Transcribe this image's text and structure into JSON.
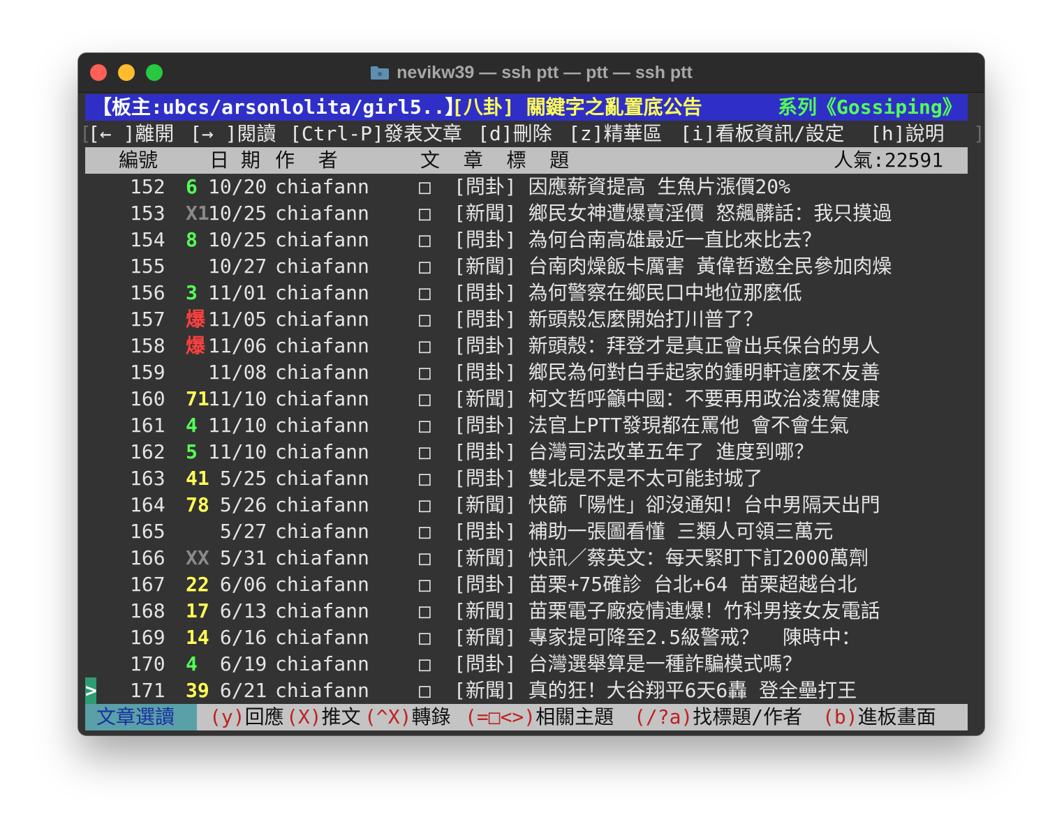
{
  "window": {
    "title": "nevikw39 — ssh ptt — ptt — ssh ptt",
    "icons": [
      "folder-icon"
    ]
  },
  "header": {
    "moderators": "【板主:ubcs/arsonlolita/girl5..】",
    "board_title": "[八卦] 關鍵字之亂置底公告",
    "series": "系列《Gossiping》"
  },
  "menu": {
    "left_edge": "[",
    "right_edge": "]",
    "items": [
      "[← ]離開",
      "[→ ]閱讀",
      "[Ctrl-P]發表文章",
      "[d]刪除",
      "[z]精華區",
      "[i]看板資訊/設定",
      "[h]說明"
    ]
  },
  "columns": {
    "number": "編號",
    "date": "日 期",
    "author": "作  者",
    "title": "文  章  標  題",
    "popularity": "人氣:22591"
  },
  "cursor": ">",
  "colors": {
    "rec_green": "#55ff55",
    "rec_yellow": "#ffff55",
    "rec_red": "#ff4040",
    "rec_gray": "#8a8a8a"
  },
  "articles": [
    {
      "num": "152",
      "rec": "6",
      "rec_color": "green",
      "date": "10/20",
      "author": "chiafann",
      "mark": "□",
      "title": "[問卦] 因應薪資提高 生魚片漲價20%"
    },
    {
      "num": "153",
      "rec": "X1",
      "rec_color": "gray",
      "date": "10/25",
      "author": "chiafann",
      "mark": "□",
      "title": "[新聞] 鄉民女神遭爆賣淫價 怒飆髒話：我只摸過"
    },
    {
      "num": "154",
      "rec": "8",
      "rec_color": "green",
      "date": "10/25",
      "author": "chiafann",
      "mark": "□",
      "title": "[問卦] 為何台南高雄最近一直比來比去？"
    },
    {
      "num": "155",
      "rec": "",
      "rec_color": "none",
      "date": "10/27",
      "author": "chiafann",
      "mark": "□",
      "title": "[新聞] 台南肉燥飯卡厲害 黃偉哲邀全民參加肉燥"
    },
    {
      "num": "156",
      "rec": "3",
      "rec_color": "green",
      "date": "11/01",
      "author": "chiafann",
      "mark": "□",
      "title": "[問卦] 為何警察在鄉民口中地位那麼低"
    },
    {
      "num": "157",
      "rec": "爆",
      "rec_color": "red",
      "date": "11/05",
      "author": "chiafann",
      "mark": "□",
      "title": "[問卦] 新頭殼怎麼開始打川普了？"
    },
    {
      "num": "158",
      "rec": "爆",
      "rec_color": "red",
      "date": "11/06",
      "author": "chiafann",
      "mark": "□",
      "title": "[問卦] 新頭殼：拜登才是真正會出兵保台的男人"
    },
    {
      "num": "159",
      "rec": "",
      "rec_color": "none",
      "date": "11/08",
      "author": "chiafann",
      "mark": "□",
      "title": "[問卦] 鄉民為何對白手起家的鍾明軒這麼不友善"
    },
    {
      "num": "160",
      "rec": "71",
      "rec_color": "yellow",
      "date": "11/10",
      "author": "chiafann",
      "mark": "□",
      "title": "[新聞] 柯文哲呼籲中國：不要再用政治凌駕健康"
    },
    {
      "num": "161",
      "rec": "4",
      "rec_color": "green",
      "date": "11/10",
      "author": "chiafann",
      "mark": "□",
      "title": "[問卦] 法官上PTT發現都在罵他 會不會生氣"
    },
    {
      "num": "162",
      "rec": "5",
      "rec_color": "green",
      "date": "11/10",
      "author": "chiafann",
      "mark": "□",
      "title": "[問卦] 台灣司法改革五年了 進度到哪？"
    },
    {
      "num": "163",
      "rec": "41",
      "rec_color": "yellow",
      "date": " 5/25",
      "author": "chiafann",
      "mark": "□",
      "title": "[問卦] 雙北是不是不太可能封城了"
    },
    {
      "num": "164",
      "rec": "78",
      "rec_color": "yellow",
      "date": " 5/26",
      "author": "chiafann",
      "mark": "□",
      "title": "[新聞] 快篩「陽性」卻沒通知！台中男隔天出門"
    },
    {
      "num": "165",
      "rec": "",
      "rec_color": "none",
      "date": " 5/27",
      "author": "chiafann",
      "mark": "□",
      "title": "[問卦] 補助一張圖看懂 三類人可領三萬元"
    },
    {
      "num": "166",
      "rec": "XX",
      "rec_color": "gray",
      "date": " 5/31",
      "author": "chiafann",
      "mark": "□",
      "title": "[新聞] 快訊／蔡英文：每天緊盯下訂2000萬劑"
    },
    {
      "num": "167",
      "rec": "22",
      "rec_color": "yellow",
      "date": " 6/06",
      "author": "chiafann",
      "mark": "□",
      "title": "[問卦] 苗栗+75確診 台北+64 苗栗超越台北"
    },
    {
      "num": "168",
      "rec": "17",
      "rec_color": "yellow",
      "date": " 6/13",
      "author": "chiafann",
      "mark": "□",
      "title": "[新聞] 苗栗電子廠疫情連爆！竹科男接女友電話"
    },
    {
      "num": "169",
      "rec": "14",
      "rec_color": "yellow",
      "date": " 6/16",
      "author": "chiafann",
      "mark": "□",
      "title": "[新聞] 專家提可降至2.5級警戒？  陳時中："
    },
    {
      "num": "170",
      "rec": "4",
      "rec_color": "green",
      "date": " 6/19",
      "author": "chiafann",
      "mark": "□",
      "title": "[問卦] 台灣選舉算是一種詐騙模式嗎？"
    },
    {
      "num": "171",
      "rec": "39",
      "rec_color": "yellow",
      "date": " 6/21",
      "author": "chiafann",
      "mark": "□",
      "title": "[新聞] 真的狂！大谷翔平6天6轟 登全壘打王"
    }
  ],
  "footer": {
    "mode": "文章選讀",
    "left_edge": "[",
    "right_edge": "]",
    "actions": [
      {
        "key": "(y)",
        "label": "回應"
      },
      {
        "key": "(X)",
        "label": "推文"
      },
      {
        "key": "(^X)",
        "label": "轉錄"
      },
      {
        "key": "(=□<>)",
        "label": "相關主題"
      },
      {
        "key": "(/?a)",
        "label": "找標題/作者"
      },
      {
        "key": "(b)",
        "label": "進板畫面"
      }
    ]
  }
}
